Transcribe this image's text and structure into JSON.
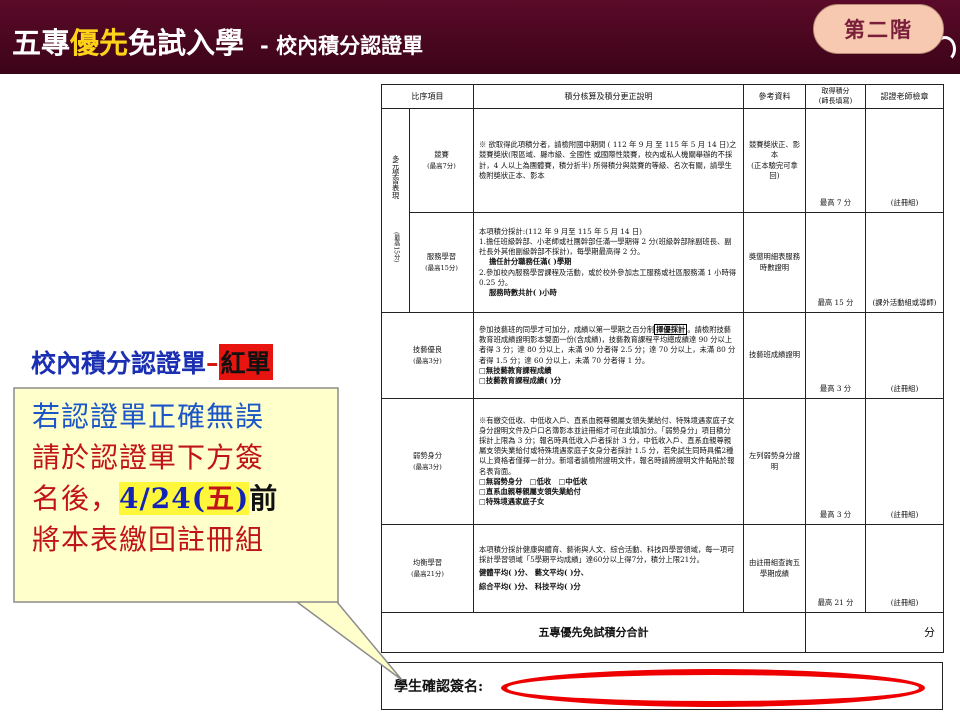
{
  "header": {
    "title_part1": "五專",
    "title_highlight": "優先",
    "title_part2": "免試入學",
    "subtitle": "- 校內積分認證單"
  },
  "badge": {
    "label": "第二階"
  },
  "form": {
    "columns": [
      "比序項目",
      "積分核算及積分更正說明",
      "參考資料",
      "取得積分\n(師長填寫)",
      "認證老師檢章"
    ],
    "category": "多元學習表現",
    "category_max": "(最高15分)",
    "rows": {
      "competition": {
        "name": "競賽",
        "max": "(最高7分)",
        "desc": "※ 欲取得此項積分者，請檢附國中期間 ( 112 年 9 月 至 115 年 5 月 14 日)之競賽獎狀(限區域、縣市級、全國性 或國際性競賽，校內或私人機關舉辦的不採計，4 人以上為團體賽，積分折半) 所得積分與競賽的等級、名次有關，請學生檢附獎狀正本、影本",
        "ref": "競賽獎狀正、影本\n(正本驗完可拿回)",
        "cap": "最高 7 分",
        "cert": "(註冊組)"
      },
      "service": {
        "name": "服務學習",
        "max": "(最高15分)",
        "desc_line1": "本項積分採計:(112 年 9 月至 115 年 5 月 14 日)",
        "desc_line2": "1.擔任班級幹部、小老師或社團幹部任滿一學期得 2 分(班級幹部除副班長、副社長外其他副級幹部不採計)，每學期最高得 2 分。",
        "desc_line3": "擔任計分職務任滿(      )學期",
        "desc_line4": "2.參加校內服務學習課程及活動，或於校外參加志工服務或社區服務滿 1 小時得 0.25 分。",
        "desc_line5": "服務時數共計(      )小時",
        "ref": "獎懲明細表服務時數證明",
        "cap": "最高 15 分",
        "cert": "(課外活動組或導師)"
      },
      "skills": {
        "name": "技藝優良",
        "max": "(最高3分)",
        "desc_pre": "參加技藝班的同學才可加分，成績以第一學期之百分制",
        "desc_boxed": "擇優採計",
        "desc_post": "。請檢附技藝教育班成績證明影本雙面一份(含成績)，技藝教育課程平均總成績達 90 分以上者得 3 分；達 80 分以上，未滿 90 分者得 2.5 分；達 70 分以上，未滿 80 分者得 1.5 分；達 60 分以上，未滿 70 分者得 1 分。",
        "opt1": "□無技藝教育課程成績",
        "opt2": "□技藝教育課程成績(      )分",
        "ref": "技藝班成績證明",
        "cap": "最高 3 分",
        "cert": "(註冊組)"
      },
      "disadvantaged": {
        "name": "弱勢身分",
        "max": "(最高3分)",
        "desc": "※有繳交低收、中低收入戶、直系血親尊親屬支領失業給付、特殊境遇家庭子女身分證明文件及戶口名簿影本並註冊組才可在此填加分。「弱勢身分」項目積分採計上限為 3 分；報名時具低收入戶者採計 3 分，中低收入戶、直系血親尊親屬支領失業給付或特殊境遇家庭子女身分者採計 1.5 分，若免試生同時具備2種以上資格者僅擇一計分。新增者請檢附證明文件，報名時請將證明文件黏貼於報名表背面。",
        "opt1": "□無弱勢身分　□低收　□中低收",
        "opt2": "□直系血親尊親屬支領失業給付",
        "opt3": "□特殊境遇家庭子女",
        "ref": "左列弱勢身分證明",
        "cap": "最高 3 分",
        "cert": "(註冊組)"
      },
      "balanced": {
        "name": "均衡學習",
        "max": "(最高21分)",
        "desc": "本項積分採計健康與體育、藝術與人文、綜合活動、科技四學習領域，每一項可採計學習領域「5學期平均成績」達60分以上得7分，積分上限21分。",
        "line1": "健體平均(    )分、 藝文平均(    )分、",
        "line2": "綜合平均(    )分、 科技平均(    )分",
        "ref": "由註冊組查詢五學期成績",
        "cap": "最高 21 分",
        "cert": "(註冊組)"
      }
    },
    "total_label": "五專優先免試積分合計",
    "total_unit": "分"
  },
  "signature": {
    "label": "學生確認簽名:"
  },
  "side_title": {
    "part1": "校內積分認證單",
    "dash": "–",
    "part2": "紅單"
  },
  "callout": {
    "line1": "若認證單正確無誤",
    "line2": "請於認證單下方簽",
    "line3": "名後，",
    "date": "4/24(",
    "weekday": "五",
    "date_end": ")",
    "before": "前",
    "line4": "將本表繳回註冊組"
  }
}
